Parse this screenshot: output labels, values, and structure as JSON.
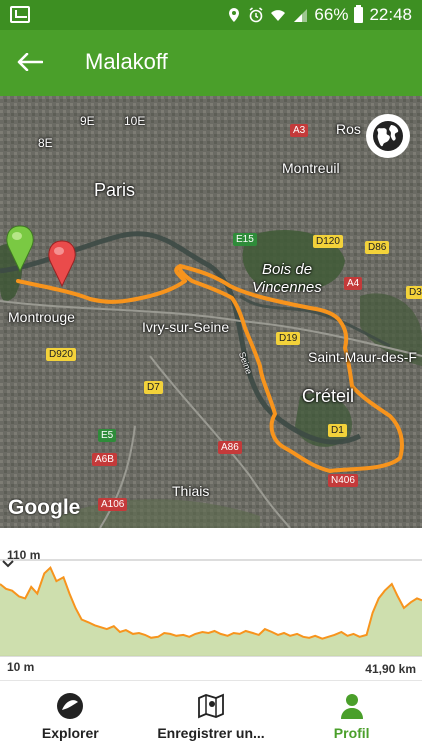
{
  "status_bar": {
    "battery": "66%",
    "time": "22:48"
  },
  "header": {
    "title": "Malakoff"
  },
  "map": {
    "labels": {
      "paris": "Paris",
      "montreuil": "Montreuil",
      "bois_de_vincennes_1": "Bois de",
      "bois_de_vincennes_2": "Vincennes",
      "montrouge": "Montrouge",
      "ivry": "Ivry-sur-Seine",
      "saint_maur": "Saint-Maur-des-F",
      "creteil": "Créteil",
      "thiais": "Thiais",
      "rosny": "Ros",
      "seine": "Seine",
      "arr_9e": "9E",
      "arr_10e": "10E",
      "arr_8e": "8E"
    },
    "roads": {
      "a3": "A3",
      "e15": "E15",
      "d120": "D120",
      "d86": "D86",
      "a4": "A4",
      "d3": "D3",
      "d19": "D19",
      "d920": "D920",
      "d7": "D7",
      "e5": "E5",
      "a6b": "A6B",
      "a86": "A86",
      "d1": "D1",
      "n406": "N406",
      "a106": "A106"
    },
    "attribution": "Google",
    "route_color": "#f7941d"
  },
  "elevation": {
    "max_label": "110 m",
    "min_label": "10 m",
    "distance_label": "41,90 km",
    "chart_data": {
      "type": "area",
      "ylim": [
        10,
        110
      ],
      "xlim": [
        0,
        41.9
      ],
      "x": [
        0,
        0.6,
        1.2,
        1.9,
        2.5,
        3.1,
        3.7,
        4.4,
        5.0,
        5.6,
        6.3,
        6.9,
        7.5,
        8.1,
        8.8,
        9.4,
        10.0,
        10.6,
        11.3,
        11.9,
        12.5,
        13.2,
        13.8,
        14.4,
        15.0,
        15.7,
        16.3,
        16.9,
        17.5,
        18.2,
        18.8,
        19.4,
        20.1,
        20.7,
        21.3,
        21.9,
        22.6,
        23.2,
        23.8,
        24.4,
        25.1,
        25.7,
        26.3,
        27.0,
        27.6,
        28.2,
        28.8,
        29.5,
        30.1,
        30.7,
        31.3,
        32.0,
        32.6,
        33.2,
        33.9,
        34.5,
        35.1,
        35.7,
        36.4,
        37.0,
        37.6,
        38.2,
        38.9,
        39.5,
        40.1,
        40.8,
        41.4,
        41.9
      ],
      "y": [
        85,
        80,
        78,
        72,
        70,
        82,
        75,
        96,
        102,
        88,
        92,
        75,
        60,
        48,
        45,
        42,
        40,
        38,
        41,
        35,
        37,
        33,
        34,
        32,
        29,
        30,
        34,
        33,
        31,
        32,
        30,
        33,
        35,
        34,
        36,
        33,
        31,
        34,
        33,
        36,
        34,
        32,
        38,
        35,
        32,
        34,
        31,
        33,
        30,
        29,
        31,
        28,
        30,
        32,
        35,
        31,
        33,
        30,
        32,
        55,
        70,
        78,
        85,
        72,
        60,
        66,
        70,
        68
      ]
    }
  },
  "bottom_nav": {
    "items": [
      {
        "label": "Explorer"
      },
      {
        "label": "Enregistrer un..."
      },
      {
        "label": "Profil"
      }
    ],
    "active_color": "#4a9f2a"
  }
}
